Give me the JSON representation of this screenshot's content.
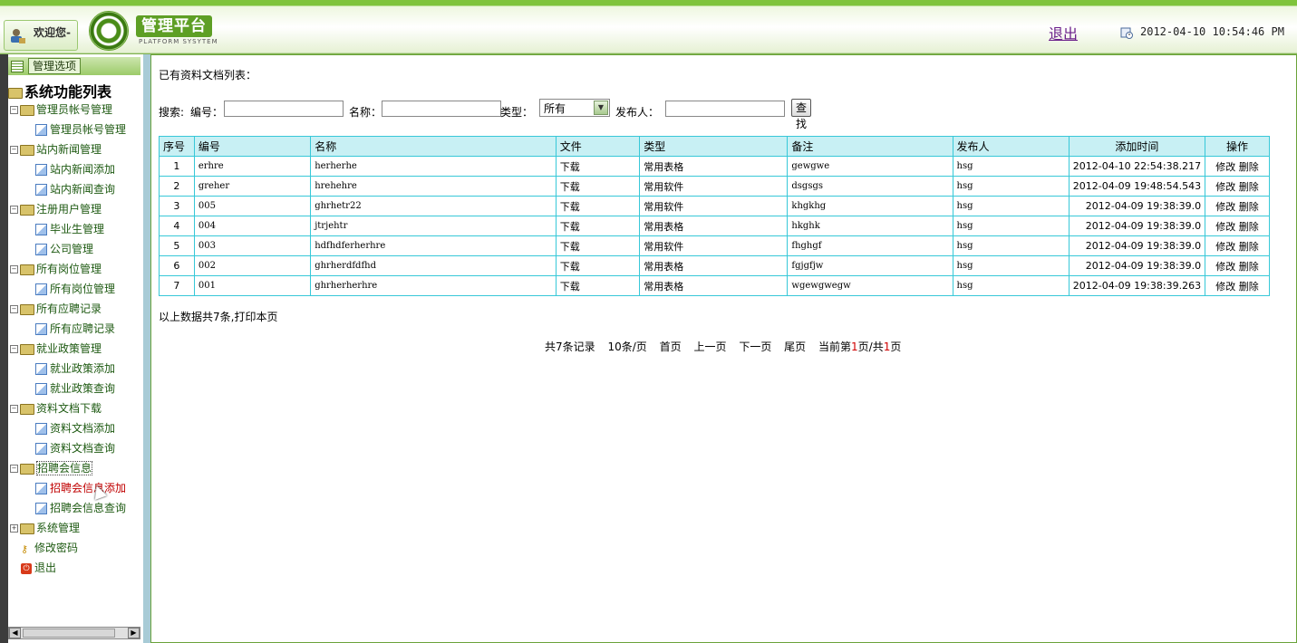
{
  "header": {
    "welcome": "欢迎您-",
    "logo_title": "管理平台",
    "logo_sub": "PLATFORM SYSYTEM",
    "logout": "退出",
    "datetime": "2012-04-10 10:54:46 PM"
  },
  "sidebar": {
    "options_button": "管理选项",
    "root": "系统功能列表",
    "groups": [
      {
        "label": "管理员帐号管理",
        "items": [
          "管理员帐号管理"
        ]
      },
      {
        "label": "站内新闻管理",
        "items": [
          "站内新闻添加",
          "站内新闻查询"
        ]
      },
      {
        "label": "注册用户管理",
        "items": [
          "毕业生管理",
          "公司管理"
        ]
      },
      {
        "label": "所有岗位管理",
        "items": [
          "所有岗位管理"
        ]
      },
      {
        "label": "所有应聘记录",
        "items": [
          "所有应聘记录"
        ]
      },
      {
        "label": "就业政策管理",
        "items": [
          "就业政策添加",
          "就业政策查询"
        ]
      },
      {
        "label": "资料文档下载",
        "items": [
          "资料文档添加",
          "资料文档查询"
        ]
      },
      {
        "label": "招聘会信息",
        "items": [
          "招聘会信息添加",
          "招聘会信息查询"
        ]
      },
      {
        "label": "系统管理",
        "items": []
      }
    ],
    "change_password": "修改密码",
    "exit": "退出"
  },
  "main": {
    "list_title": "已有资料文档列表：",
    "search": {
      "prefix": "搜索:",
      "code_label": "编号：",
      "name_label": "名称：",
      "type_label": "类型：",
      "type_value": "所有",
      "publisher_label": "发布人：",
      "find_button": "查找"
    },
    "table": {
      "headers": [
        "序号",
        "编号",
        "名称",
        "文件",
        "类型",
        "备注",
        "发布人",
        "添加时间",
        "操作"
      ],
      "rows": [
        {
          "no": "1",
          "code": "erhre",
          "name": "herherhe",
          "file": "下载",
          "type": "常用表格",
          "note": "gewgwe",
          "publisher": "hsg",
          "time": "2012-04-10 22:54:38.217",
          "edit": "修改",
          "del": "删除"
        },
        {
          "no": "2",
          "code": "greher",
          "name": "hrehehre",
          "file": "下载",
          "type": "常用软件",
          "note": "dsgsgs",
          "publisher": "hsg",
          "time": "2012-04-09 19:48:54.543",
          "edit": "修改",
          "del": "删除"
        },
        {
          "no": "3",
          "code": "005",
          "name": "ghrhetr22",
          "file": "下载",
          "type": "常用软件",
          "note": "khgkhg",
          "publisher": "hsg",
          "time": "2012-04-09 19:38:39.0",
          "edit": "修改",
          "del": "删除"
        },
        {
          "no": "4",
          "code": "004",
          "name": "jtrjehtr",
          "file": "下载",
          "type": "常用表格",
          "note": "hkghk",
          "publisher": "hsg",
          "time": "2012-04-09 19:38:39.0",
          "edit": "修改",
          "del": "删除"
        },
        {
          "no": "5",
          "code": "003",
          "name": "hdfhdferherhre",
          "file": "下载",
          "type": "常用软件",
          "note": "fhghgf",
          "publisher": "hsg",
          "time": "2012-04-09 19:38:39.0",
          "edit": "修改",
          "del": "删除"
        },
        {
          "no": "6",
          "code": "002",
          "name": "ghrherdfdfhd",
          "file": "下载",
          "type": "常用表格",
          "note": "fgjgfjw",
          "publisher": "hsg",
          "time": "2012-04-09 19:38:39.0",
          "edit": "修改",
          "del": "删除"
        },
        {
          "no": "7",
          "code": "001",
          "name": "ghrherherhre",
          "file": "下载",
          "type": "常用表格",
          "note": "wgewgwegw",
          "publisher": "hsg",
          "time": "2012-04-09 19:38:39.263",
          "edit": "修改",
          "del": "删除"
        }
      ]
    },
    "total_note": "以上数据共7条,打印本页",
    "pager": {
      "total": "共7条记录",
      "per_page": "10条/页",
      "first": "首页",
      "prev": "上一页",
      "next": "下一页",
      "last": "尾页",
      "current_prefix": "当前第",
      "current": "1",
      "current_mid": "页/共",
      "pages": "1",
      "current_suffix": "页"
    }
  }
}
